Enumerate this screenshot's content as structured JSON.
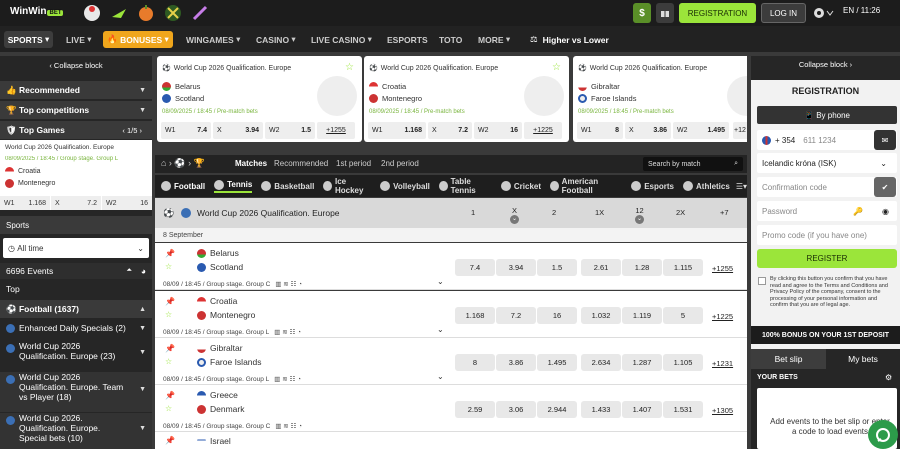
{
  "header": {
    "logo": "WinWin",
    "logo_badge": "BET",
    "deposit": "$",
    "registration": "REGISTRATION",
    "login": "LOG IN",
    "lang": "EN / 11:26"
  },
  "nav": [
    "SPORTS",
    "LIVE",
    "BONUSES",
    "WINGAMES",
    "CASINO",
    "LIVE CASINO",
    "ESPORTS",
    "TOTO",
    "MORE",
    "Higher vs Lower"
  ],
  "left": {
    "collapse": "Collapse block",
    "recommended": "Recommended",
    "top_competitions": "Top competitions",
    "top_games": "Top Games",
    "top_games_page": "1/5",
    "top_game": {
      "league": "World Cup 2026 Qualification. Europe",
      "date": "08/09/2025 / 18:45 / Group stage. Group L",
      "t1": "Croatia",
      "t2": "Montenegro",
      "odds": [
        [
          "W1",
          "1.168"
        ],
        [
          "X",
          "7.2"
        ],
        [
          "W2",
          "16"
        ]
      ]
    },
    "sports": "Sports",
    "all_time": "All time",
    "events": "6696 Events",
    "top": "Top",
    "football": "Football (1637)",
    "leagues": [
      "Enhanced Daily Specials (2)",
      "World Cup 2026 Qualification. Europe (23)",
      "World Cup 2026 Qualification. Europe. Team vs Player (18)",
      "World Cup 2026. Qualification. Europe. Special bets (10)"
    ]
  },
  "cards": [
    {
      "league": "World Cup 2026 Qualification. Europe",
      "t1": "Belarus",
      "t2": "Scotland",
      "date": "08/09/2025 / 18:45 / Pre-match bets",
      "o": [
        [
          "W1",
          "7.4"
        ],
        [
          "X",
          "3.94"
        ],
        [
          "W2",
          "1.5"
        ]
      ],
      "more": "+1255"
    },
    {
      "league": "World Cup 2026 Qualification. Europe",
      "t1": "Croatia",
      "t2": "Montenegro",
      "date": "08/09/2025 / 18:45 / Pre-match bets",
      "o": [
        [
          "W1",
          "1.168"
        ],
        [
          "X",
          "7.2"
        ],
        [
          "W2",
          "16"
        ]
      ],
      "more": "+1225"
    },
    {
      "league": "World Cup 2026 Qualification. Europe",
      "t1": "Gibraltar",
      "t2": "Faroe Islands",
      "date": "08/09/2025 / 18:45 / Pre-match bets",
      "o": [
        [
          "W1",
          "8"
        ],
        [
          "X",
          "3.86"
        ],
        [
          "W2",
          "1.495"
        ]
      ],
      "more": "+12"
    }
  ],
  "tabs": [
    "Matches",
    "Recommended",
    "1st period",
    "2nd period"
  ],
  "search": "Search by match",
  "sports_bar": [
    "Football",
    "Tennis",
    "Basketball",
    "Ice Hockey",
    "Volleyball",
    "Table Tennis",
    "Cricket",
    "American Football",
    "Esports",
    "Athletics"
  ],
  "league_header": {
    "title": "World Cup 2026 Qualification. Europe",
    "cols": [
      "1",
      "X",
      "2",
      "1X",
      "12",
      "2X",
      "+7"
    ]
  },
  "date_label": "8 September",
  "matches": [
    {
      "t1": "Belarus",
      "t2": "Scotland",
      "info": "08/09 / 18:45 / Group stage. Group C",
      "odds": [
        "7.4",
        "3.94",
        "1.5",
        "2.61",
        "1.28",
        "1.115"
      ],
      "more": "+1255"
    },
    {
      "t1": "Croatia",
      "t2": "Montenegro",
      "info": "08/09 / 18:45 / Group stage. Group L",
      "odds": [
        "1.168",
        "7.2",
        "16",
        "1.032",
        "1.119",
        "5"
      ],
      "more": "+1225"
    },
    {
      "t1": "Gibraltar",
      "t2": "Faroe Islands",
      "info": "08/09 / 18:45 / Group stage. Group L",
      "odds": [
        "8",
        "3.86",
        "1.495",
        "2.634",
        "1.287",
        "1.105"
      ],
      "more": "+1231"
    },
    {
      "t1": "Greece",
      "t2": "Denmark",
      "info": "08/09 / 18:45 / Group stage. Group C",
      "odds": [
        "2.59",
        "3.06",
        "2.944",
        "1.433",
        "1.407",
        "1.531"
      ],
      "more": "+1305"
    },
    {
      "t1": "Israel",
      "t2": "",
      "info": "",
      "odds": [],
      "more": ""
    }
  ],
  "right": {
    "collapse": "Collapse block",
    "registration": "REGISTRATION",
    "by_phone": "By phone",
    "code": "+ 354",
    "phone_ph": "611 1234",
    "currency": "Icelandic króna (ISK)",
    "confirm_ph": "Confirmation code",
    "password_ph": "Password",
    "promo_ph": "Promo code (if you have one)",
    "register": "REGISTER",
    "terms": "By clicking this button you confirm that you have read and agree to the Terms and Conditions and Privacy Policy of the company, consent to the processing of your personal information and confirm that you are of legal age.",
    "bonus": "100% BONUS ON YOUR 1ST DEPOSIT",
    "bet_slip": "Bet slip",
    "my_bets": "My bets",
    "your_bets": "YOUR BETS",
    "empty": "Add events to the bet slip or enter a code to load events"
  },
  "colors": {
    "accent": "#9be53a",
    "bonus": "#f0a61c",
    "date": "#78b43c"
  }
}
